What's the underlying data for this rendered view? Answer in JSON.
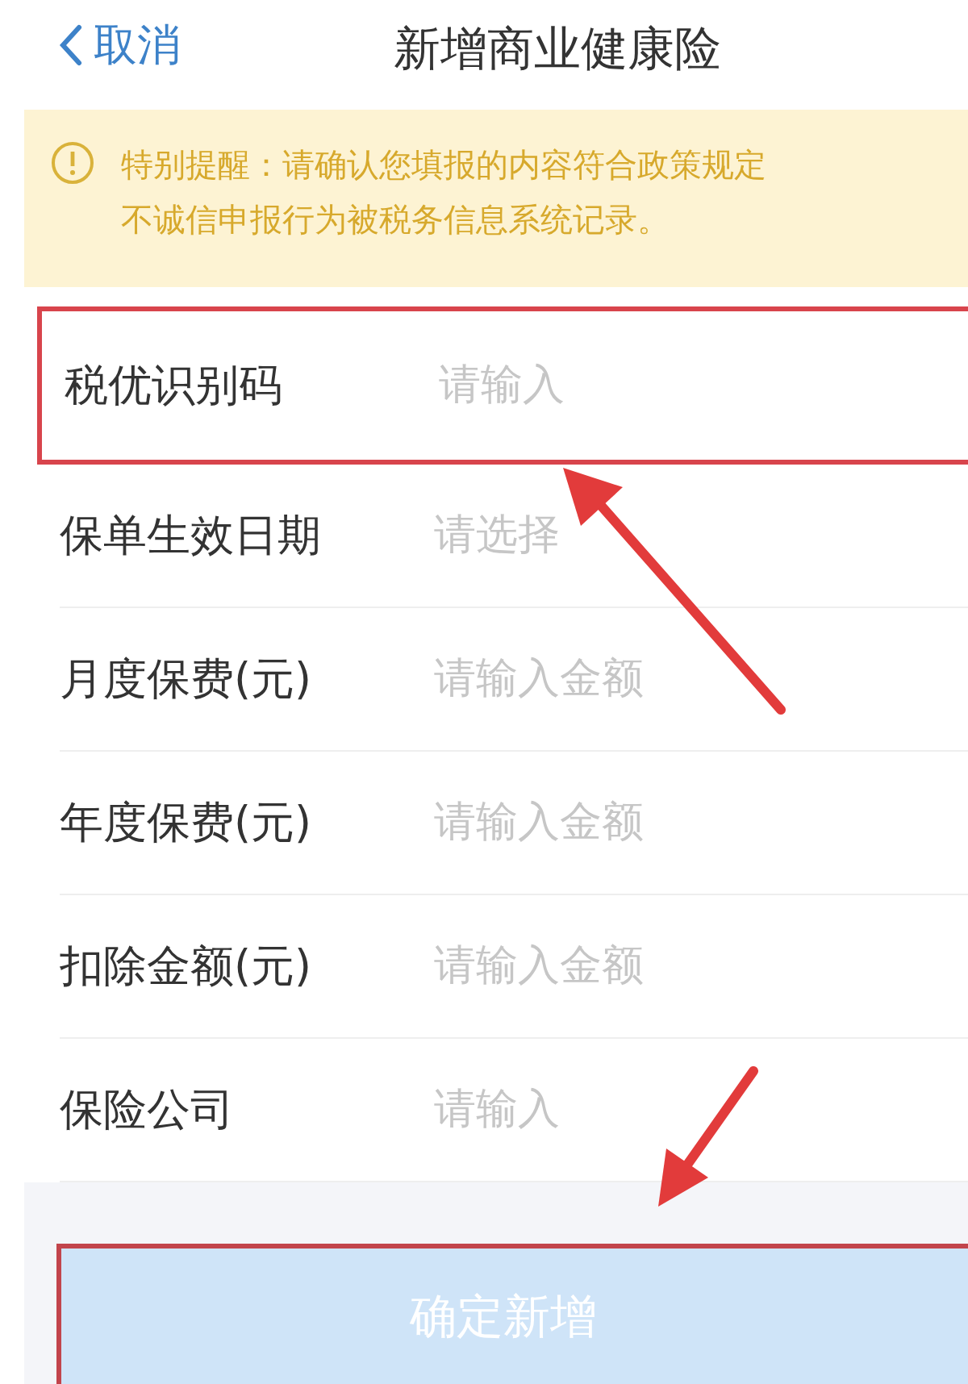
{
  "nav_bar": {
    "back": "取消",
    "title": "新增商业健康险"
  },
  "notice": {
    "lines": [
      "特别提醒：请确认您填报的内容符合政策规定",
      "不诚信申报行为被税务信息系统记录。"
    ]
  },
  "form_rows": [
    {
      "label": "税优识别码",
      "placeholder": "请输入",
      "highlighted": true
    },
    {
      "label": "保单生效日期",
      "placeholder": "请选择",
      "highlighted": false
    },
    {
      "label": "月度保费(元)",
      "placeholder": "请输入金额",
      "highlighted": false
    },
    {
      "label": "年度保费(元)",
      "placeholder": "请输入金额",
      "highlighted": false
    },
    {
      "label": "扣除金额(元)",
      "placeholder": "请输入金额",
      "highlighted": false
    },
    {
      "label": "保险公司",
      "placeholder": "请输入",
      "highlighted": false
    }
  ],
  "submit_button": {
    "label": "确定新增",
    "disabled": true,
    "highlighted": true
  }
}
